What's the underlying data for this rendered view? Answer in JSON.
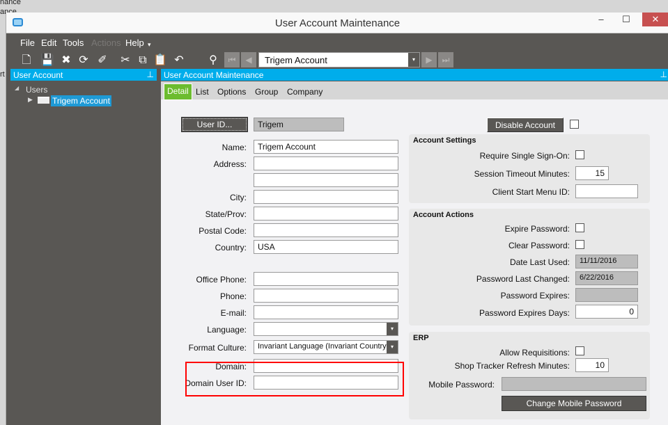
{
  "background": {
    "fragments": [
      "nance",
      "ance",
      "rt"
    ]
  },
  "window": {
    "title": "User Account Maintenance",
    "minimize": "–",
    "maximize": "☐",
    "close": "✕"
  },
  "menu": {
    "items": [
      "File",
      "Edit",
      "Tools",
      "Actions",
      "Help"
    ],
    "more": "▾"
  },
  "toolbar": {
    "record": "Trigem Account",
    "dropdown": "▾"
  },
  "left_panel": {
    "header": "User Account",
    "pin": "⊥",
    "tree_root": "Users",
    "tree_item": "Trigem Account"
  },
  "right_panel": {
    "header": "User Account Maintenance",
    "pin": "⊥"
  },
  "tabs": [
    "Detail",
    "List",
    "Options",
    "Group",
    "Company"
  ],
  "form": {
    "user_id_button": "User ID...",
    "user_id": "Trigem",
    "name_label": "Name:",
    "name": "Trigem Account",
    "address_label": "Address:",
    "address1": "",
    "address2": "",
    "city_label": "City:",
    "city": "",
    "state_label": "State/Prov:",
    "state": "",
    "postal_label": "Postal Code:",
    "postal": "",
    "country_label": "Country:",
    "country": "USA",
    "office_phone_label": "Office Phone:",
    "office_phone": "",
    "phone_label": "Phone:",
    "phone": "",
    "email_label": "E-mail:",
    "email": "",
    "language_label": "Language:",
    "language": "",
    "format_culture_label": "Format Culture:",
    "format_culture": "Invariant Language (Invariant Country)",
    "domain_label": "Domain:",
    "domain": "",
    "domain_user_label": "Domain User ID:",
    "domain_user": ""
  },
  "disable_account": {
    "label": "Disable Account",
    "checked": false
  },
  "account_settings": {
    "title": "Account Settings",
    "sso_label": "Require Single Sign-On:",
    "timeout_label": "Session Timeout Minutes:",
    "timeout": "15",
    "start_menu_label": "Client Start Menu ID:",
    "start_menu": ""
  },
  "account_actions": {
    "title": "Account Actions",
    "expire_label": "Expire Password:",
    "clear_label": "Clear Password:",
    "date_last_used_label": "Date Last Used:",
    "date_last_used": "11/11/2016",
    "pwd_changed_label": "Password Last Changed:",
    "pwd_changed": "6/22/2016",
    "pwd_expires_label": "Password Expires:",
    "pwd_expires": "",
    "pwd_days_label": "Password Expires Days:",
    "pwd_days": "0"
  },
  "erp": {
    "title": "ERP",
    "allow_req_label": "Allow Requisitions:",
    "shop_tracker_label": "Shop Tracker Refresh Minutes:",
    "shop_tracker": "10",
    "mobile_pwd_label": "Mobile Password:",
    "mobile_pwd": "",
    "change_mobile_button": "Change Mobile Password"
  },
  "colors": {
    "accent": "#00adeb",
    "active_tab": "#6cbc2f",
    "dark": "#595754",
    "highlight": "#ff0000"
  }
}
